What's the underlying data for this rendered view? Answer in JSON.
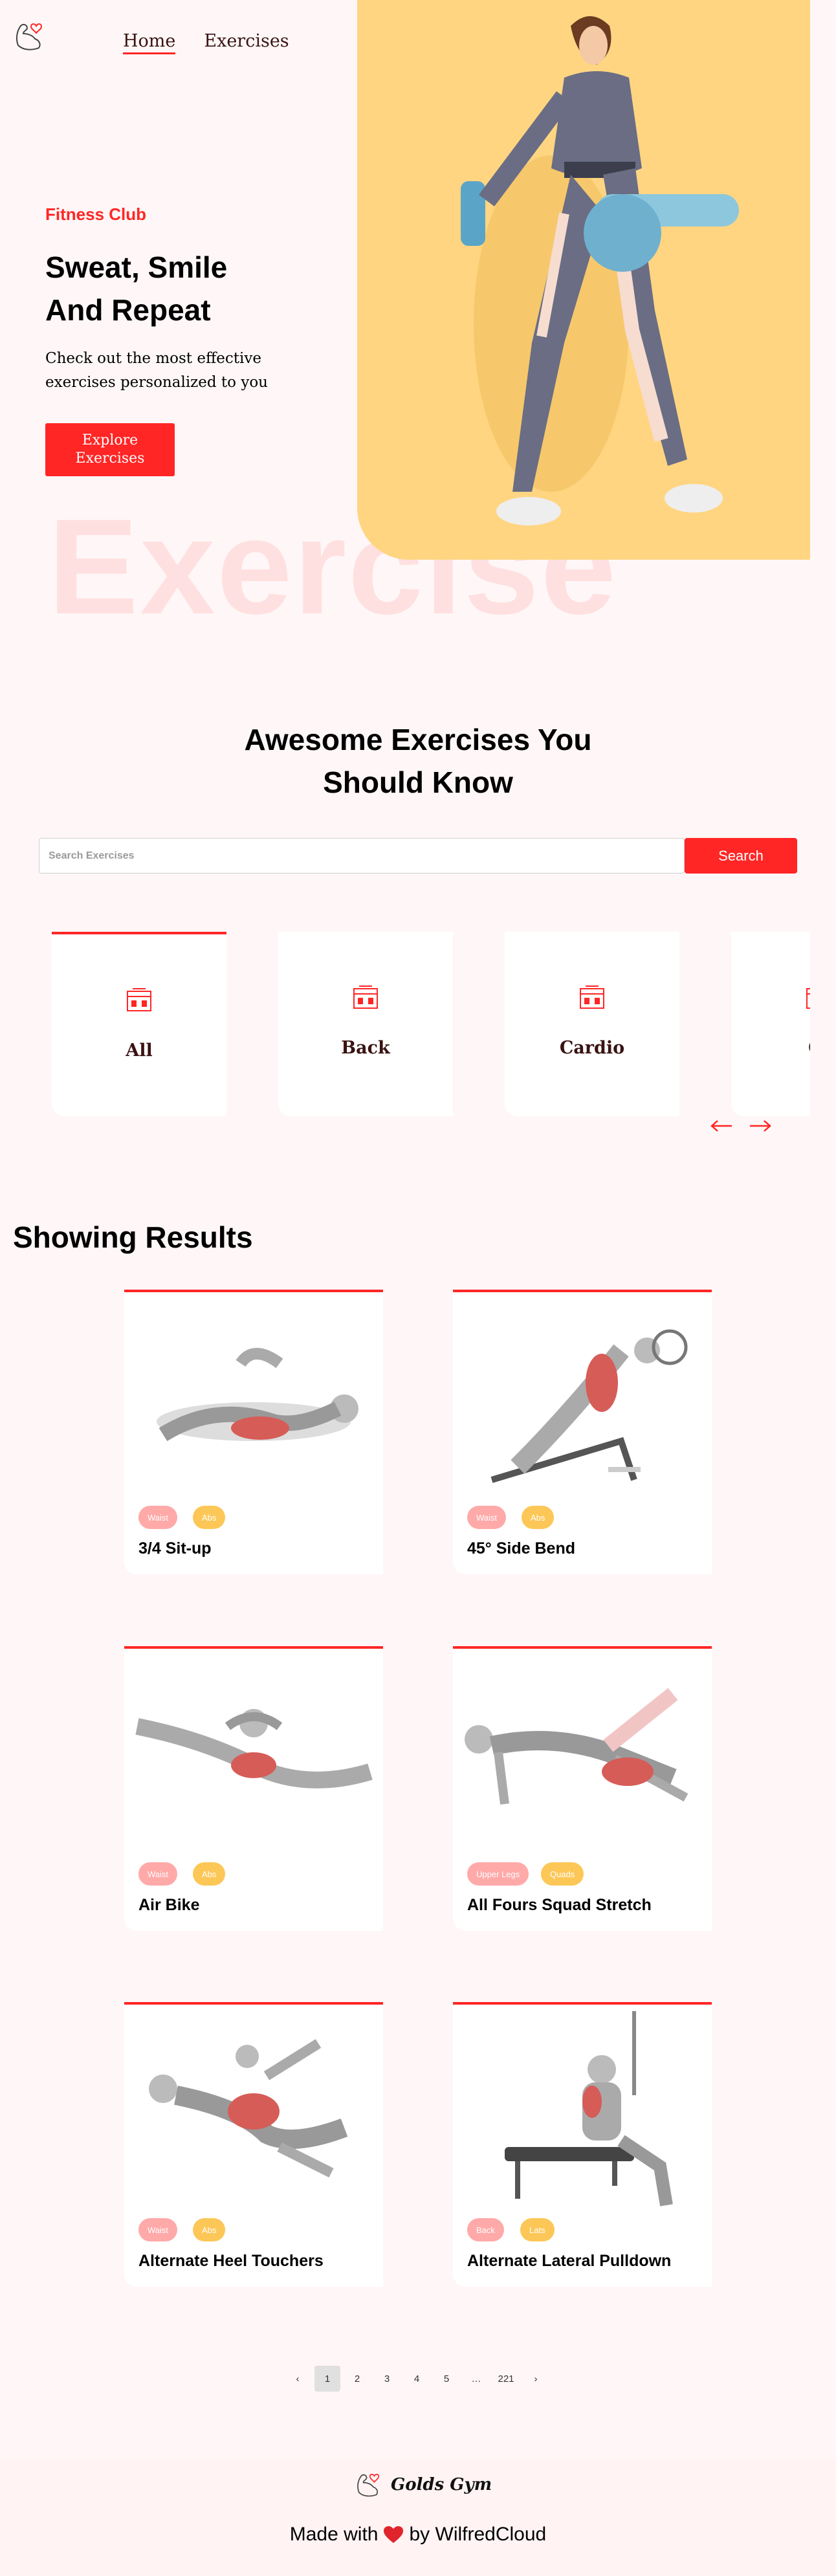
{
  "nav": {
    "home": "Home",
    "exercises": "Exercises"
  },
  "hero": {
    "kicker": "Fitness Club",
    "title": "Sweat, Smile And Repeat",
    "subtitle": "Check out the most effective exercises personalized to you",
    "button": "Explore Exercises",
    "watermark": "Exercise"
  },
  "search": {
    "title": "Awesome Exercises You Should Know",
    "placeholder": "Search Exercises",
    "button": "Search"
  },
  "body_parts": [
    {
      "label": "All",
      "selected": true
    },
    {
      "label": "Back",
      "selected": false
    },
    {
      "label": "Cardio",
      "selected": false
    },
    {
      "label": "Cl",
      "selected": false
    }
  ],
  "results": {
    "title": "Showing Results",
    "items": [
      {
        "name": "3/4 Sit-up",
        "tags": [
          "Waist",
          "Abs"
        ]
      },
      {
        "name": "45° Side Bend",
        "tags": [
          "Waist",
          "Abs"
        ]
      },
      {
        "name": "Air Bike",
        "tags": [
          "Waist",
          "Abs"
        ]
      },
      {
        "name": "All Fours Squad Stretch",
        "tags": [
          "Upper Legs",
          "Quads"
        ]
      },
      {
        "name": "Alternate Heel Touchers",
        "tags": [
          "Waist",
          "Abs"
        ]
      },
      {
        "name": "Alternate Lateral Pulldown",
        "tags": [
          "Back",
          "Lats"
        ]
      }
    ]
  },
  "pagination": {
    "prev": "‹",
    "pages": [
      "1",
      "2",
      "3",
      "4",
      "5",
      "…",
      "221"
    ],
    "next": "›",
    "current": "1"
  },
  "footer": {
    "brand": "Golds Gym",
    "made_prefix": "Made with",
    "made_suffix": "by WilfredCloud"
  },
  "colors": {
    "accent": "#ff2625",
    "hero_bg": "#ffd581",
    "tag_pink": "#ffa9a9",
    "tag_yellow": "#fcc757",
    "page_bg": "#fff7f7"
  }
}
